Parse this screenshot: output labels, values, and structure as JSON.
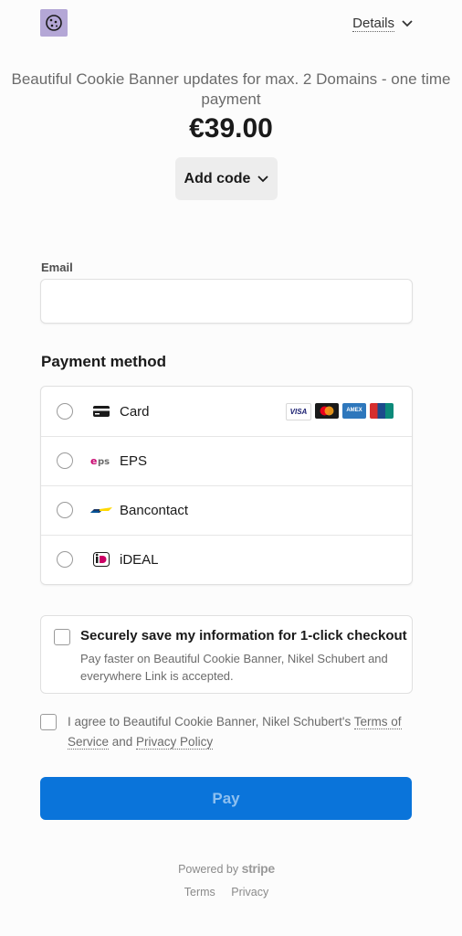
{
  "header": {
    "details_label": "Details"
  },
  "product": {
    "name": "Beautiful Cookie Banner updates for max. 2 Domains - one time payment",
    "price": "€39.00"
  },
  "add_code_label": "Add code",
  "email": {
    "label": "Email",
    "value": "",
    "placeholder": ""
  },
  "payment": {
    "title": "Payment method",
    "methods": [
      {
        "label": "Card",
        "icon": "card-icon"
      },
      {
        "label": "EPS",
        "icon": "eps-icon"
      },
      {
        "label": "Bancontact",
        "icon": "bancontact-icon"
      },
      {
        "label": "iDEAL",
        "icon": "ideal-icon"
      }
    ],
    "card_brands": [
      "VISA",
      "Mastercard",
      "AMEX",
      "UnionPay"
    ]
  },
  "save": {
    "title": "Securely save my information for 1-click checkout",
    "description": "Pay faster on Beautiful Cookie Banner, Nikel Schubert and everywhere Link is accepted."
  },
  "terms": {
    "prefix": "I agree to Beautiful Cookie Banner, Nikel Schubert's ",
    "tos": "Terms of Service",
    "and": " and ",
    "privacy": "Privacy Policy"
  },
  "pay_label": "Pay",
  "footer": {
    "powered_by": "Powered by",
    "brand": "stripe",
    "terms": "Terms",
    "privacy": "Privacy"
  },
  "colors": {
    "accent": "#0a74da"
  }
}
